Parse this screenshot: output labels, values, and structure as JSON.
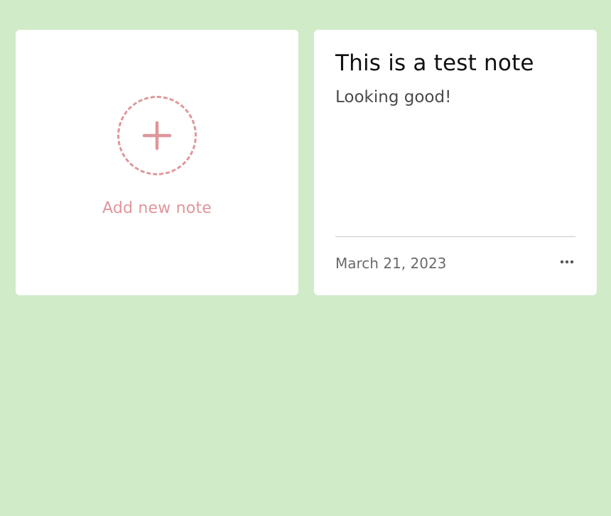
{
  "add_note": {
    "label": "Add new note",
    "icon": "plus-icon"
  },
  "notes": [
    {
      "title": "This is a test note",
      "body": "Looking good!",
      "date": "March 21, 2023",
      "menu_icon": "more-horizontal-icon"
    }
  ],
  "colors": {
    "background": "#cfebc8",
    "card": "#ffffff",
    "accent": "#e0969a",
    "title": "#111111",
    "body": "#4a4a4a",
    "date": "#6a6a6a"
  }
}
